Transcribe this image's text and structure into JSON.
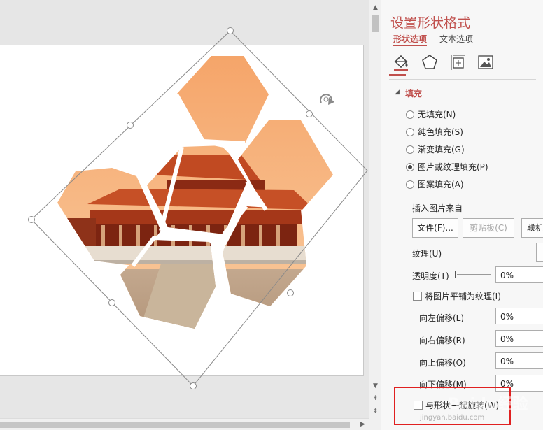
{
  "pane": {
    "title": "设置形状格式",
    "tab_shape_options": "形状选项",
    "tab_text_options": "文本选项",
    "icons": [
      "fill-line-icon",
      "effects-pentagon-icon",
      "size-properties-icon",
      "picture-icon"
    ],
    "fill_section": "填充",
    "fill_options": [
      {
        "label": "无填充(N)",
        "selected": false
      },
      {
        "label": "纯色填充(S)",
        "selected": false
      },
      {
        "label": "渐变填充(G)",
        "selected": false
      },
      {
        "label": "图片或纹理填充(P)",
        "selected": true
      },
      {
        "label": "图案填充(A)",
        "selected": false
      }
    ],
    "insert_from_label": "插入图片来自",
    "file_button": "文件(F)...",
    "clipboard_button": "剪贴板(C)",
    "online_button": "联机",
    "texture_label": "纹理(U)",
    "transparency_label": "透明度(T)",
    "transparency_value": "0%",
    "tile_checkbox_label": "将图片平铺为纹理(I)",
    "tile_checked": false,
    "offsets": [
      {
        "label": "向左偏移(L)",
        "value": "0%"
      },
      {
        "label": "向右偏移(R)",
        "value": "0%"
      },
      {
        "label": "向上偏移(O)",
        "value": "0%"
      },
      {
        "label": "向下偏移(M)",
        "value": "0%"
      }
    ],
    "rotate_checkbox_label": "与形状一起旋转(W)",
    "rotate_checked": false
  },
  "watermark": {
    "main": "Baidu经验",
    "sub": "jingyan.baidu.com"
  },
  "colors": {
    "accent": "#c0504d",
    "highlight": "#e02020",
    "hex_top": "#f6a46a",
    "hex_bottom": "#f8c893"
  }
}
